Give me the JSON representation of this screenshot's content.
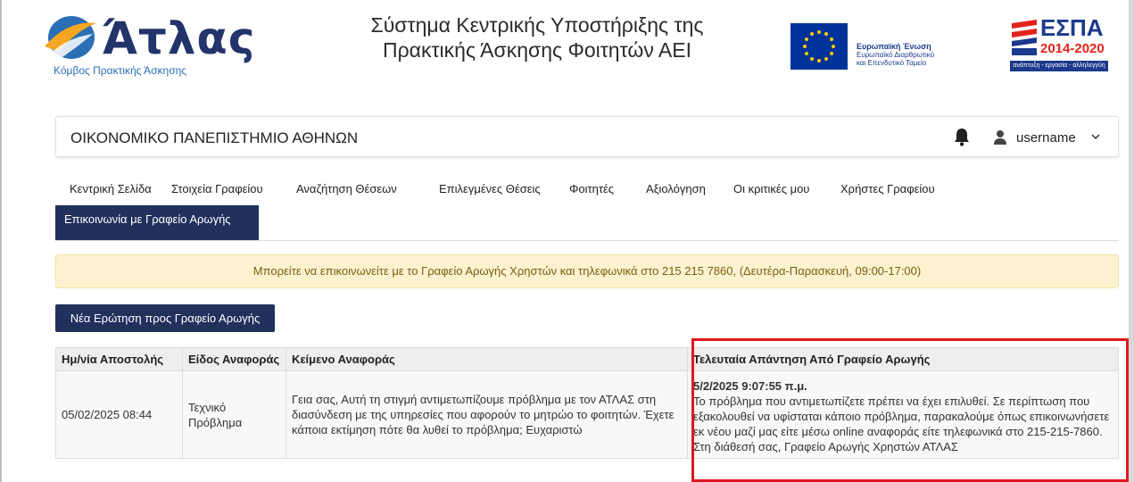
{
  "header": {
    "logo_word": "Άτλας",
    "logo_sub": "Κόμβος Πρακτικής Άσκησης",
    "system_title_line1": "Σύστημα Κεντρικής Υποστήριξης της",
    "system_title_line2": "Πρακτικής Άσκησης Φοιτητών ΑΕΙ",
    "eu_title": "Ευρωπαϊκή Ένωση",
    "eu_line1": "Ευρωπαϊκό Διαρθρωτικό",
    "eu_line2": "και Επενδυτικό Ταμείο",
    "espa_word": "ΕΣΠΑ",
    "espa_years": "2014-2020",
    "espa_slogan": "ανάπτυξη - εργασία - αλληλεγγύη"
  },
  "topbar": {
    "university": "ΟΙΚΟΝΟΜΙΚΟ ΠΑΝΕΠΙΣΤΗΜΙΟ ΑΘΗΝΩΝ",
    "username": "username"
  },
  "nav": {
    "items": [
      "Κεντρική Σελίδα",
      "Στοιχεία Γραφείου",
      "Αναζήτηση Θέσεων",
      "Επιλεγμένες Θέσεις",
      "Φοιτητές",
      "Αξιολόγηση",
      "Οι κριτικές μου",
      "Χρήστες Γραφείου"
    ],
    "active": "Επικοινωνία με Γραφείο Αρωγής"
  },
  "banner": "Μπορείτε να επικοινωνείτε με το Γραφείο Αρωγής Χρηστών και τηλεφωνικά στο 215 215 7860, (Δευτέρα-Παρασκευή, 09:00-17:00)",
  "new_question_button": "Νέα Ερώτηση προς Γραφείο Αρωγής",
  "table": {
    "headers": [
      "Ημ/νία Αποστολής",
      "Είδος Αναφοράς",
      "Κείμενο Αναφοράς",
      "Τελευταία Απάντηση Από Γραφείο Αρωγής"
    ],
    "rows": [
      {
        "date": "05/02/2025 08:44",
        "type": "Τεχνικό Πρόβλημα",
        "text": "Γεια σας, Αυτή τη στιγμή αντιμετωπίζουμε πρόβλημα με τον ΑΤΛΑΣ στη διασύνδεση με της υπηρεσίες που αφορούν το μητρώο το φοιτητών. Έχετε κάποια εκτίμηση πότε θα λυθεί το πρόβλημα; Ευχαριστώ",
        "reply_time": "5/2/2025 9:07:55 π.μ.",
        "reply": "Το πρόβλημα που αντιμετωπίζετε πρέπει να έχει επιλυθεί. Σε περίπτωση που εξακολουθεί να υφίσταται κάποιο πρόβλημα, παρακαλούμε όπως επικοινωνήσετε εκ νέου μαζί μας είτε μέσω online αναφοράς είτε τηλεφωνικά στο 215-215-7860. Στη διάθεσή σας, Γραφείο Αρωγής Χρηστών ΑΤΛΑΣ"
      }
    ]
  },
  "colors": {
    "navy": "#22305c",
    "banner_bg": "#fcf2d0",
    "highlight": "#e0171e"
  }
}
